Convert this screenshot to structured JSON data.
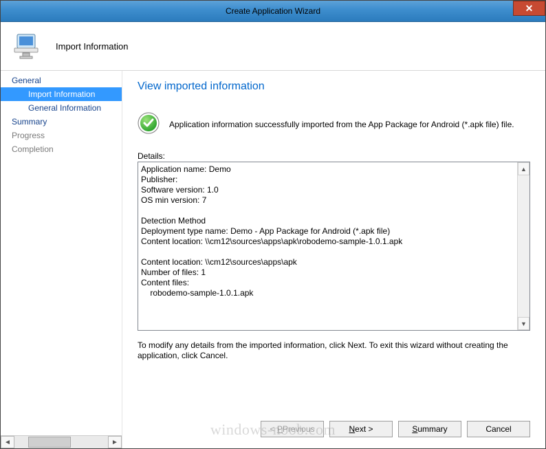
{
  "window": {
    "title": "Create Application Wizard"
  },
  "header": {
    "title": "Import Information"
  },
  "sidebar": {
    "items": [
      {
        "label": "General"
      },
      {
        "label": "Import Information"
      },
      {
        "label": "General Information"
      },
      {
        "label": "Summary"
      },
      {
        "label": "Progress"
      },
      {
        "label": "Completion"
      }
    ]
  },
  "main": {
    "heading": "View imported information",
    "status_message": "Application information successfully imported from the App Package for Android (*.apk file) file.",
    "details_label": "Details:",
    "details_text": "Application name: Demo\nPublisher:\nSoftware version: 1.0\nOS min version: 7\n\nDetection Method\nDeployment type name: Demo - App Package for Android (*.apk file)\nContent location: \\\\cm12\\sources\\apps\\apk\\robodemo-sample-1.0.1.apk\n\nContent location: \\\\cm12\\sources\\apps\\apk\nNumber of files: 1\nContent files:\n    robodemo-sample-1.0.1.apk",
    "hint": "To modify any details from the imported information, click Next. To exit this wizard without creating the application, click Cancel."
  },
  "buttons": {
    "previous": "Previous",
    "next": "Next >",
    "summary": "Summary",
    "cancel": "Cancel"
  },
  "watermark": "windows-noob.com"
}
